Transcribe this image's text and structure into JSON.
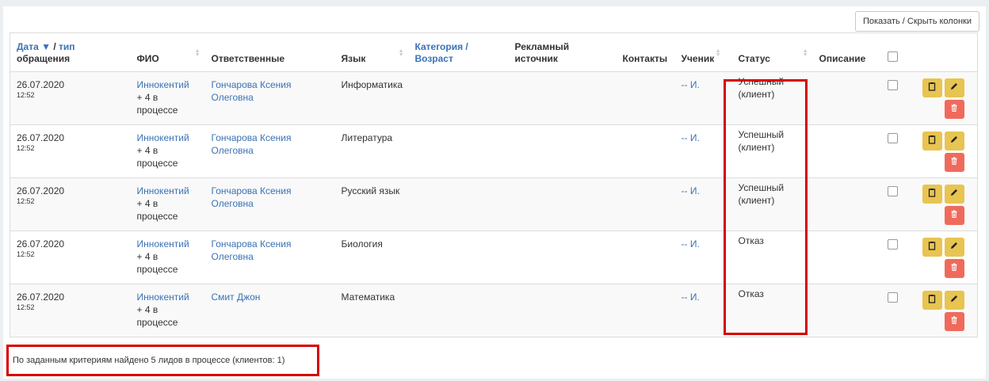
{
  "toolbar": {
    "toggle_columns_label": "Показать / Скрыть колонки"
  },
  "columns": {
    "date_link": "Дата ▼",
    "type_sep": " / ",
    "type_link": "тип",
    "type_rest": "обращения",
    "fio": "ФИО",
    "responsible": "Ответственные",
    "language": "Язык",
    "category": "Категория /",
    "age": "Возраст",
    "ad_source": "Рекламный источник",
    "contacts": "Контакты",
    "student": "Ученик",
    "status": "Статус",
    "description": "Описание"
  },
  "rows": [
    {
      "date": "26.07.2020",
      "time": "12:52",
      "fio": "Иннокентий",
      "fio_extra": "+ 4 в процессе",
      "responsible": "Гончарова Ксения Олеговна",
      "language": "Информатика",
      "student": "-- И.",
      "status": "Успешный (клиент)"
    },
    {
      "date": "26.07.2020",
      "time": "12:52",
      "fio": "Иннокентий",
      "fio_extra": "+ 4 в процессе",
      "responsible": "Гончарова Ксения Олеговна",
      "language": "Литература",
      "student": "-- И.",
      "status": "Успешный (клиент)"
    },
    {
      "date": "26.07.2020",
      "time": "12:52",
      "fio": "Иннокентий",
      "fio_extra": "+ 4 в процессе",
      "responsible": "Гончарова Ксения Олеговна",
      "language": "Русский язык",
      "student": "-- И.",
      "status": "Успешный (клиент)"
    },
    {
      "date": "26.07.2020",
      "time": "12:52",
      "fio": "Иннокентий",
      "fio_extra": "+ 4 в процессе",
      "responsible": "Гончарова Ксения Олеговна",
      "language": "Биология",
      "student": "-- И.",
      "status": "Отказ"
    },
    {
      "date": "26.07.2020",
      "time": "12:52",
      "fio": "Иннокентий",
      "fio_extra": "+ 4 в процессе",
      "responsible": "Смит Джон",
      "language": "Математика",
      "student": "-- И.",
      "status": "Отказ"
    }
  ],
  "footer": {
    "summary": "По заданным критериям найдено 5 лидов в процессе (клиентов: 1)"
  },
  "colors": {
    "link": "#3a72b5",
    "action_yellow": "#e8c451",
    "action_red": "#f06a5c",
    "highlight": "#d60000"
  },
  "icons": {
    "copy": "clipboard-icon",
    "edit": "pencil-icon",
    "delete": "trash-icon"
  }
}
